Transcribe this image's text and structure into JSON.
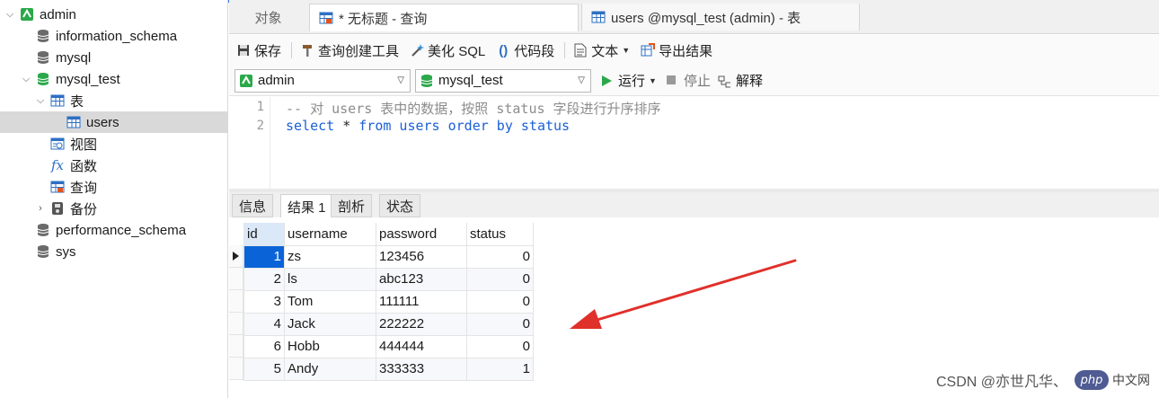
{
  "sidebar": {
    "items": [
      {
        "label": "admin",
        "icon": "connection-icon",
        "expanded": true,
        "level": 0
      },
      {
        "label": "information_schema",
        "icon": "database-icon",
        "level": 1
      },
      {
        "label": "mysql",
        "icon": "database-icon",
        "level": 1
      },
      {
        "label": "mysql_test",
        "icon": "database-icon-green",
        "expanded": true,
        "level": 1
      },
      {
        "label": "表",
        "icon": "table-group-icon",
        "expanded": true,
        "level": 2
      },
      {
        "label": "users",
        "icon": "table-icon",
        "level": 3,
        "selected": true
      },
      {
        "label": "视图",
        "icon": "view-icon",
        "level": 2
      },
      {
        "label": "函数",
        "icon": "function-icon",
        "level": 2
      },
      {
        "label": "查询",
        "icon": "query-icon",
        "level": 2
      },
      {
        "label": "备份",
        "icon": "backup-icon",
        "collapsed": true,
        "level": 2
      },
      {
        "label": "performance_schema",
        "icon": "database-icon",
        "level": 1
      },
      {
        "label": "sys",
        "icon": "database-icon",
        "level": 1
      }
    ]
  },
  "tabs": {
    "objects": "对象",
    "query": "* 无标题 - 查询",
    "table": "users @mysql_test (admin) - 表"
  },
  "toolbar": {
    "save": "保存",
    "query_builder": "查询创建工具",
    "beautify": "美化 SQL",
    "snippet": "代码段",
    "text": "文本",
    "export": "导出结果"
  },
  "selectors": {
    "connection": "admin",
    "database": "mysql_test",
    "run": "运行",
    "stop": "停止",
    "explain": "解释"
  },
  "editor": {
    "line_numbers": [
      "1",
      "2"
    ],
    "line1": "-- 对 users 表中的数据，按照 status 字段进行升序排序",
    "line2_kw1": "select",
    "line2_star": " * ",
    "line2_kw2": "from",
    "line2_tbl": " users ",
    "line2_kw3": "order by",
    "line2_col": " status"
  },
  "result_tabs": [
    "信息",
    "结果 1",
    "剖析",
    "状态"
  ],
  "grid": {
    "columns": [
      "id",
      "username",
      "password",
      "status"
    ],
    "rows": [
      {
        "id": "1",
        "username": "zs",
        "password": "123456",
        "status": "0"
      },
      {
        "id": "2",
        "username": "ls",
        "password": "abc123",
        "status": "0"
      },
      {
        "id": "3",
        "username": "Tom",
        "password": "111111",
        "status": "0"
      },
      {
        "id": "4",
        "username": "Jack",
        "password": "222222",
        "status": "0"
      },
      {
        "id": "6",
        "username": "Hobb",
        "password": "444444",
        "status": "0"
      },
      {
        "id": "5",
        "username": "Andy",
        "password": "333333",
        "status": "1"
      }
    ]
  },
  "watermark": {
    "text": "CSDN @亦世凡华、",
    "php": "php",
    "site": "中文网"
  },
  "colors": {
    "accent": "#0a64d8",
    "keyword": "#1a5fd6",
    "arrow": "#e0302a"
  }
}
